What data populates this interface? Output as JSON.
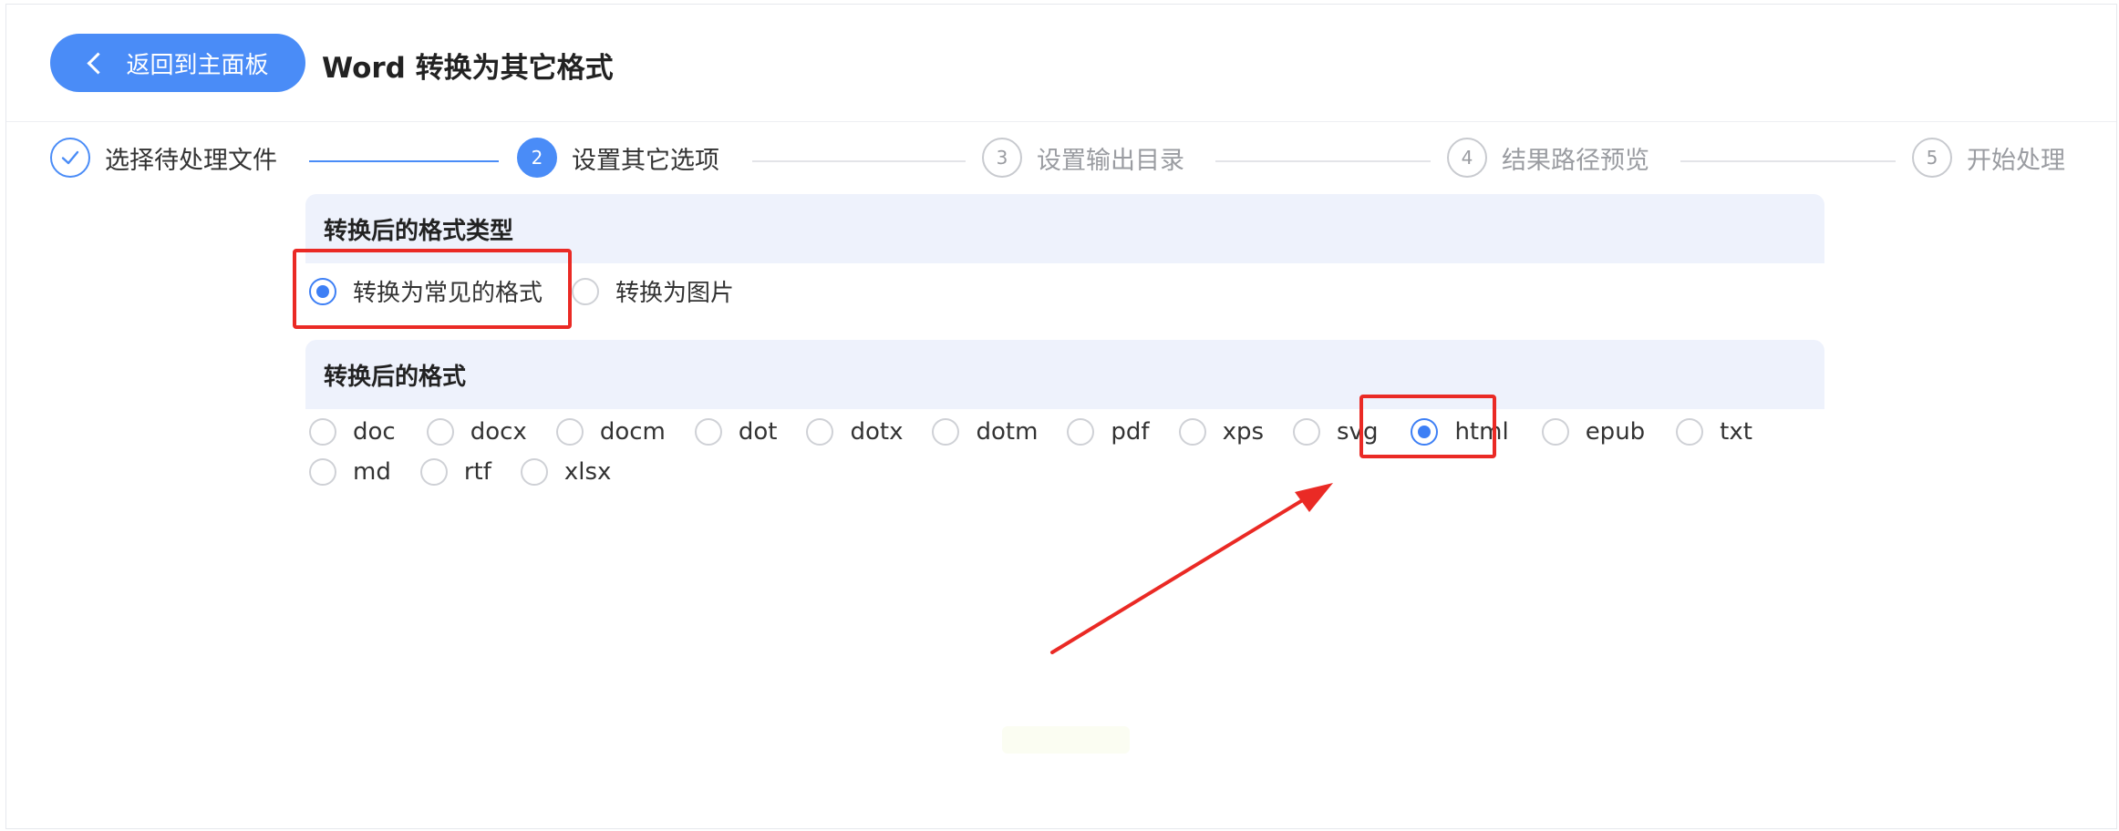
{
  "header": {
    "back_label": "返回到主面板",
    "title": "Word 转换为其它格式"
  },
  "steps": [
    {
      "number": "1",
      "label": "选择待处理文件",
      "state": "done"
    },
    {
      "number": "2",
      "label": "设置其它选项",
      "state": "active"
    },
    {
      "number": "3",
      "label": "设置输出目录",
      "state": "pending"
    },
    {
      "number": "4",
      "label": "结果路径预览",
      "state": "pending"
    },
    {
      "number": "5",
      "label": "开始处理",
      "state": "pending"
    }
  ],
  "format_type": {
    "title": "转换后的格式类型",
    "options": [
      {
        "label": "转换为常见的格式",
        "checked": true
      },
      {
        "label": "转换为图片",
        "checked": false
      }
    ]
  },
  "format": {
    "title": "转换后的格式",
    "options_row1": [
      {
        "label": "doc",
        "checked": false
      },
      {
        "label": "docx",
        "checked": false
      },
      {
        "label": "docm",
        "checked": false
      },
      {
        "label": "dot",
        "checked": false
      },
      {
        "label": "dotx",
        "checked": false
      },
      {
        "label": "dotm",
        "checked": false
      },
      {
        "label": "pdf",
        "checked": false
      },
      {
        "label": "xps",
        "checked": false
      },
      {
        "label": "svg",
        "checked": false
      },
      {
        "label": "html",
        "checked": true
      },
      {
        "label": "epub",
        "checked": false
      },
      {
        "label": "txt",
        "checked": false
      }
    ],
    "options_row2": [
      {
        "label": "md",
        "checked": false
      },
      {
        "label": "rtf",
        "checked": false
      },
      {
        "label": "xlsx",
        "checked": false
      }
    ]
  },
  "colors": {
    "accent": "#4a8cf7",
    "highlight": "#ea2a25",
    "section_bg": "#eef2fc"
  }
}
